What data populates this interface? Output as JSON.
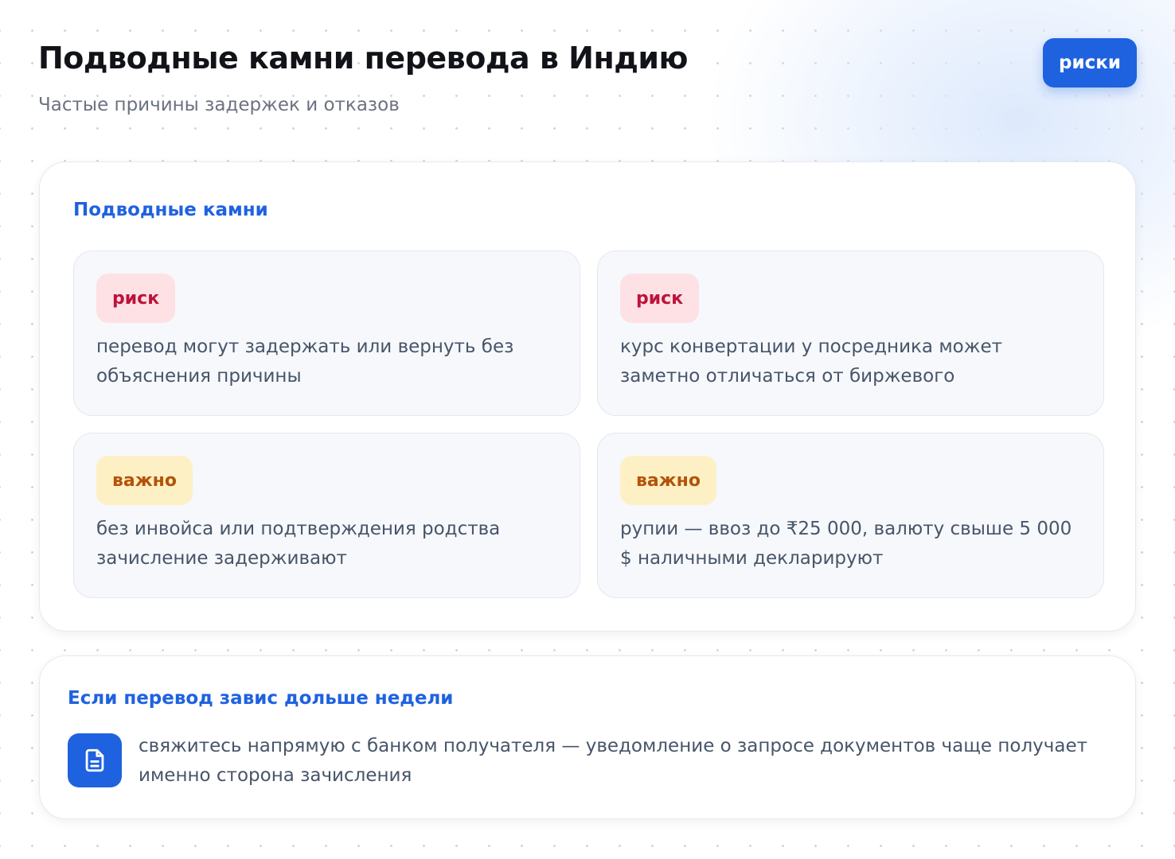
{
  "header": {
    "title": "Подводные камни перевода в Индию",
    "subtitle": "Частые причины задержек и отказов",
    "badge": "риски"
  },
  "pitfalls": {
    "heading": "Подводные камни",
    "items": [
      {
        "tag": "риск",
        "kind": "risk",
        "text": "перевод могут задержать или вернуть без объяснения причины"
      },
      {
        "tag": "риск",
        "kind": "risk",
        "text": "курс конвертации у посредника может заметно отличаться от биржевого"
      },
      {
        "tag": "важно",
        "kind": "important",
        "text": "без инвойса или подтверждения родства зачисление задерживают"
      },
      {
        "tag": "важно",
        "kind": "important",
        "text": "рупии — ввоз до ₹25 000, валюту свыше 5 000 $ наличными декларируют"
      }
    ]
  },
  "tip": {
    "heading": "Если перевод завис дольше недели",
    "icon": "document-icon",
    "text": "свяжитесь напрямую с банком получателя — уведомление о запросе документов чаще получает именно сторона зачисления"
  },
  "colors": {
    "accent": "#1f62e0",
    "risk_bg": "#fde1e4",
    "risk_text": "#be123c",
    "important_bg": "#fdf0c4",
    "important_text": "#b45309"
  }
}
